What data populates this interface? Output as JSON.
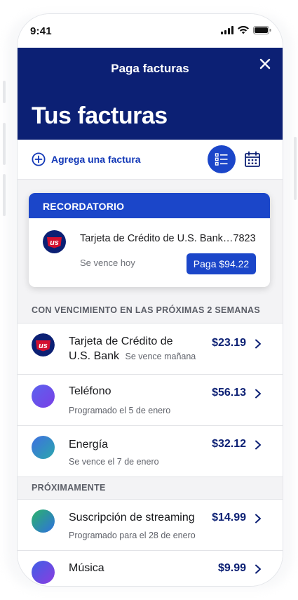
{
  "status_bar": {
    "time": "9:41"
  },
  "header": {
    "title": "Paga facturas",
    "heading": "Tus facturas"
  },
  "toolbar": {
    "add_bill_label": "Agrega una factura"
  },
  "reminder": {
    "header": "RECORDATORIO",
    "bill_name": "Tarjeta de Crédito de U.S. Bank…7823",
    "due": "Se vence hoy",
    "pay_button": "Paga $94.22",
    "logo_text": "us"
  },
  "sections": {
    "upcoming_two_weeks": "CON VENCIMIENTO EN LAS PRÓXIMAS 2 SEMANAS",
    "soon": "PRÓXIMAMENTE"
  },
  "bills": [
    {
      "name_line1": "Tarjeta de Crédito de",
      "name_line2": "U.S. Bank",
      "status": "Se vence mañana",
      "amount": "$23.19",
      "logo_text": "us"
    },
    {
      "name": "Teléfono",
      "status": "Programado el 5 de enero",
      "amount": "$56.13"
    },
    {
      "name": "Energía",
      "status": "Se vence el 7 de enero",
      "amount": "$32.12"
    },
    {
      "name": "Suscripción de streaming",
      "status": "Programado para el 28 de enero",
      "amount": "$14.99"
    },
    {
      "name": "Música",
      "status": "",
      "amount": "$9.99"
    }
  ],
  "colors": {
    "header_bg": "#0c2074",
    "accent": "#1b46c9",
    "link": "#1238b7",
    "amount": "#0c2074"
  }
}
